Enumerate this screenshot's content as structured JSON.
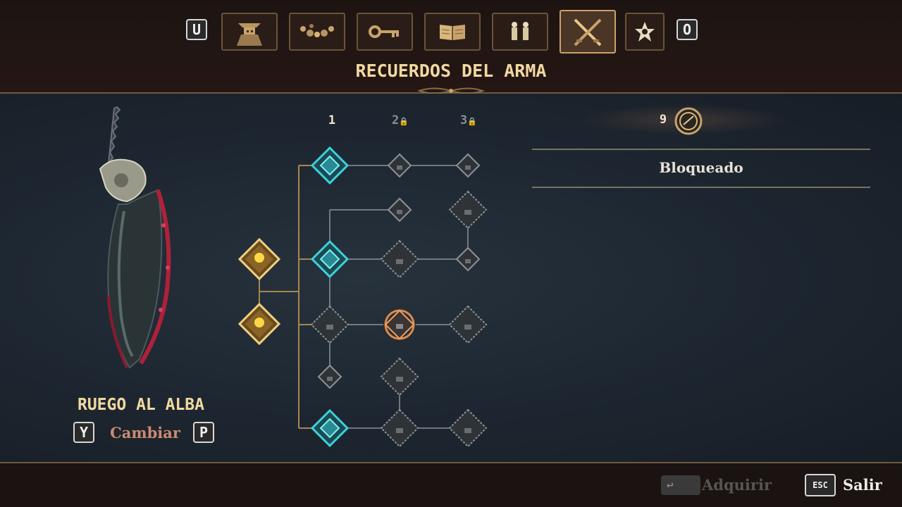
{
  "colors": {
    "gold": "#f2d9a0",
    "teal": "#38b6c0",
    "locked": "#8a8f94",
    "orange": "#e08a4a",
    "accent_text": "#c98b72"
  },
  "header": {
    "prev_key": "U",
    "next_key": "O",
    "tabs": [
      {
        "icon": "character-portrait-icon",
        "active": false
      },
      {
        "icon": "rosary-beads-icon",
        "active": false
      },
      {
        "icon": "key-icon",
        "active": false
      },
      {
        "icon": "book-icon",
        "active": false
      },
      {
        "icon": "figurines-icon",
        "active": false
      },
      {
        "icon": "crossed-swords-icon",
        "active": true
      },
      {
        "icon": "star-emblem-icon",
        "active": false
      }
    ],
    "title": "RECUERDOS DEL ARMA"
  },
  "weapon": {
    "name": "RUEGO AL ALBA",
    "prev_key": "Y",
    "next_key": "P",
    "change_label": "Cambiar"
  },
  "tree": {
    "columns": [
      {
        "label": "1",
        "locked": false
      },
      {
        "label": "2",
        "locked": true
      },
      {
        "label": "3",
        "locked": true
      }
    ]
  },
  "info": {
    "cost": "9",
    "cost_icon": "memory-orb-icon",
    "status": "Bloqueado"
  },
  "footer": {
    "acquire_key": "↩",
    "acquire_label": "Adquirir",
    "exit_key": "ESC",
    "exit_label": "Salir"
  }
}
